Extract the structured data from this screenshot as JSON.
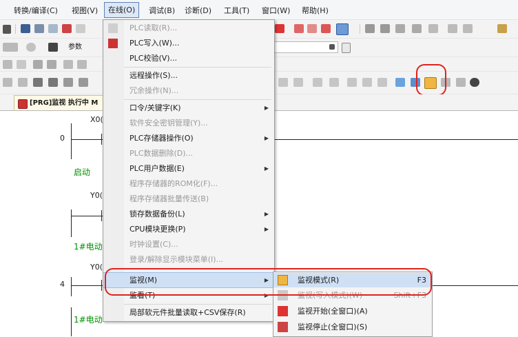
{
  "menubar": {
    "items": [
      "转换/编译(C)",
      "视图(V)",
      "在线(O)",
      "调试(B)",
      "诊断(D)",
      "工具(T)",
      "窗口(W)",
      "帮助(H)"
    ]
  },
  "toolbar": {
    "combo_label": "参数"
  },
  "document_tab": {
    "label": "[PRG]监视 执行中 M"
  },
  "ladder": {
    "rung_numbers": [
      "0",
      "4"
    ],
    "contacts": [
      "X0(",
      "Y0(",
      "Y0("
    ],
    "comments": [
      "启动",
      "1#电动",
      "1#电动"
    ]
  },
  "online_menu": {
    "items": [
      {
        "label": "PLC读取(R)...",
        "enabled": false,
        "submenu": false
      },
      {
        "label": "PLC写入(W)...",
        "enabled": true,
        "submenu": false
      },
      {
        "label": "PLC校验(V)...",
        "enabled": true,
        "submenu": false
      },
      {
        "label": "远程操作(S)...",
        "enabled": true,
        "submenu": false
      },
      {
        "label": "冗余操作(N)...",
        "enabled": false,
        "submenu": false
      },
      {
        "label": "口令/关键字(K)",
        "enabled": true,
        "submenu": true
      },
      {
        "label": "软件安全密钥管理(Y)...",
        "enabled": false,
        "submenu": false
      },
      {
        "label": "PLC存储器操作(O)",
        "enabled": true,
        "submenu": true
      },
      {
        "label": "PLC数据删除(D)...",
        "enabled": false,
        "submenu": false
      },
      {
        "label": "PLC用户数据(E)",
        "enabled": true,
        "submenu": true
      },
      {
        "label": "程序存储器的ROM化(F)...",
        "enabled": false,
        "submenu": false
      },
      {
        "label": "程序存储器批量传送(B)",
        "enabled": false,
        "submenu": false
      },
      {
        "label": "锁存数据备份(L)",
        "enabled": true,
        "submenu": true
      },
      {
        "label": "CPU模块更换(P)",
        "enabled": true,
        "submenu": true
      },
      {
        "label": "时钟设置(C)...",
        "enabled": false,
        "submenu": false
      },
      {
        "label": "登录/解除显示模块菜单(I)...",
        "enabled": false,
        "submenu": false
      },
      {
        "label": "监视(M)",
        "enabled": true,
        "submenu": true
      },
      {
        "label": "监看(T)",
        "enabled": true,
        "submenu": true
      },
      {
        "label": "局部软元件批量读取+CSV保存(R)",
        "enabled": true,
        "submenu": false
      }
    ]
  },
  "monitor_submenu": {
    "items": [
      {
        "label": "监视模式(R)",
        "shortcut": "F3",
        "enabled": true
      },
      {
        "label": "监视(写入模式)(W)",
        "shortcut": "Shift+F3",
        "enabled": false
      },
      {
        "label": "监视开始(全窗口)(A)",
        "shortcut": "",
        "enabled": true
      },
      {
        "label": "监视停止(全窗口)(S)",
        "shortcut": "",
        "enabled": true
      }
    ]
  },
  "colors": {
    "highlight_oval": "#e0211c",
    "menu_background": "#f4f4f4",
    "comment_green": "#009000"
  }
}
